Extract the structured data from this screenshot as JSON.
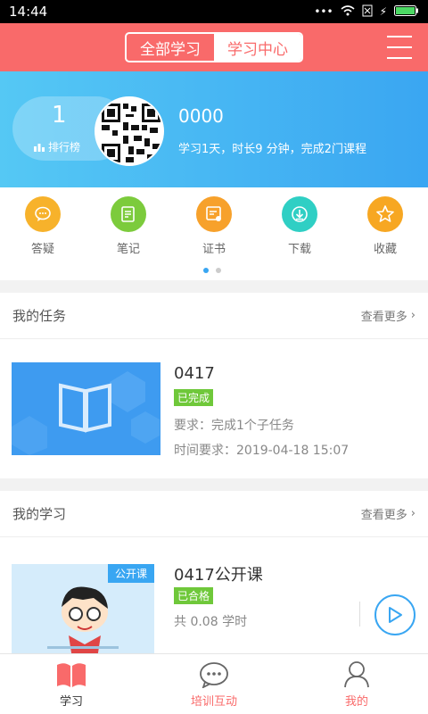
{
  "status": {
    "time": "14:44",
    "icons": [
      "signal-dots-icon",
      "wifi-icon",
      "sim-icon",
      "charging-icon",
      "battery-icon"
    ]
  },
  "header": {
    "segments": [
      {
        "label": "全部学习",
        "active": false
      },
      {
        "label": "学习中心",
        "active": true
      }
    ],
    "menu_icon": "menu-icon"
  },
  "profile": {
    "rank_number": "1",
    "rank_label": "排行榜",
    "username": "0000",
    "summary": "学习1天，时长9 分钟，完成2门课程"
  },
  "shortcuts": [
    {
      "label": "答疑",
      "icon": "chat-bubble-icon",
      "color": "#f7b22b"
    },
    {
      "label": "笔记",
      "icon": "notebook-icon",
      "color": "#7ccb3c"
    },
    {
      "label": "证书",
      "icon": "certificate-icon",
      "color": "#f7a12b"
    },
    {
      "label": "下载",
      "icon": "download-icon",
      "color": "#2fcfc4"
    },
    {
      "label": "收藏",
      "icon": "star-icon",
      "color": "#f7a722"
    }
  ],
  "tasks": {
    "title": "我的任务",
    "more": "查看更多",
    "item": {
      "name": "0417",
      "status": "已完成",
      "requirement": "要求：完成1个子任务",
      "time": "时间要求：2019-04-18 15:07"
    }
  },
  "learning": {
    "title": "我的学习",
    "more": "查看更多",
    "item": {
      "name": "0417公开课",
      "tag": "公开课",
      "status": "已合格",
      "hours": "共 0.08 学时"
    }
  },
  "tabs": [
    {
      "label": "学习",
      "icon": "book-icon",
      "active": true,
      "color": "#333333"
    },
    {
      "label": "培训互动",
      "icon": "message-icon",
      "active": false,
      "color": "#f96a6a"
    },
    {
      "label": "我的",
      "icon": "user-icon",
      "active": false,
      "color": "#f96a6a"
    }
  ],
  "colors": {
    "brand": "#f96a6a",
    "accent": "#39a6f2",
    "success": "#6fc83a"
  }
}
